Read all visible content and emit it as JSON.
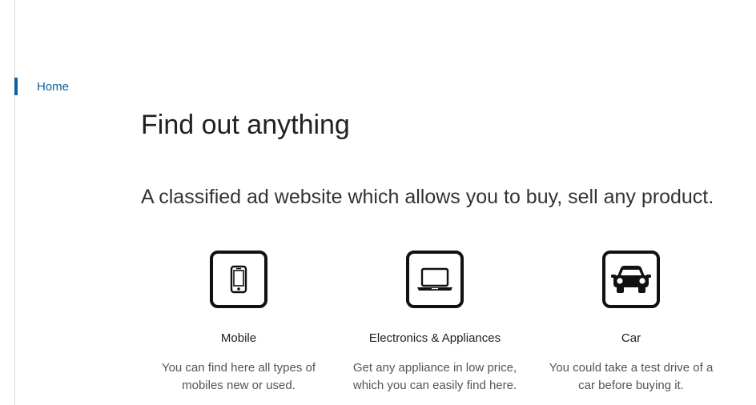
{
  "nav": {
    "items": [
      {
        "label": "Home",
        "active": true
      }
    ]
  },
  "hero": {
    "title": "Find out anything",
    "subtitle": "A classified ad website which allows you to buy, sell any product."
  },
  "features": [
    {
      "icon": "mobile-phone-icon",
      "title": "Mobile",
      "desc_line1": "You can find here all types of",
      "desc_line2": "mobiles new or used."
    },
    {
      "icon": "laptop-icon",
      "title": "Electronics & Appliances",
      "desc_line1": "Get any appliance in low price,",
      "desc_line2": "which you can easily find here."
    },
    {
      "icon": "car-icon",
      "title": "Car",
      "desc_line1": "You could take a test drive of a",
      "desc_line2": "car before buying it."
    }
  ],
  "colors": {
    "accent": "#0f5f9c",
    "text": "#212121",
    "muted": "#555555"
  }
}
